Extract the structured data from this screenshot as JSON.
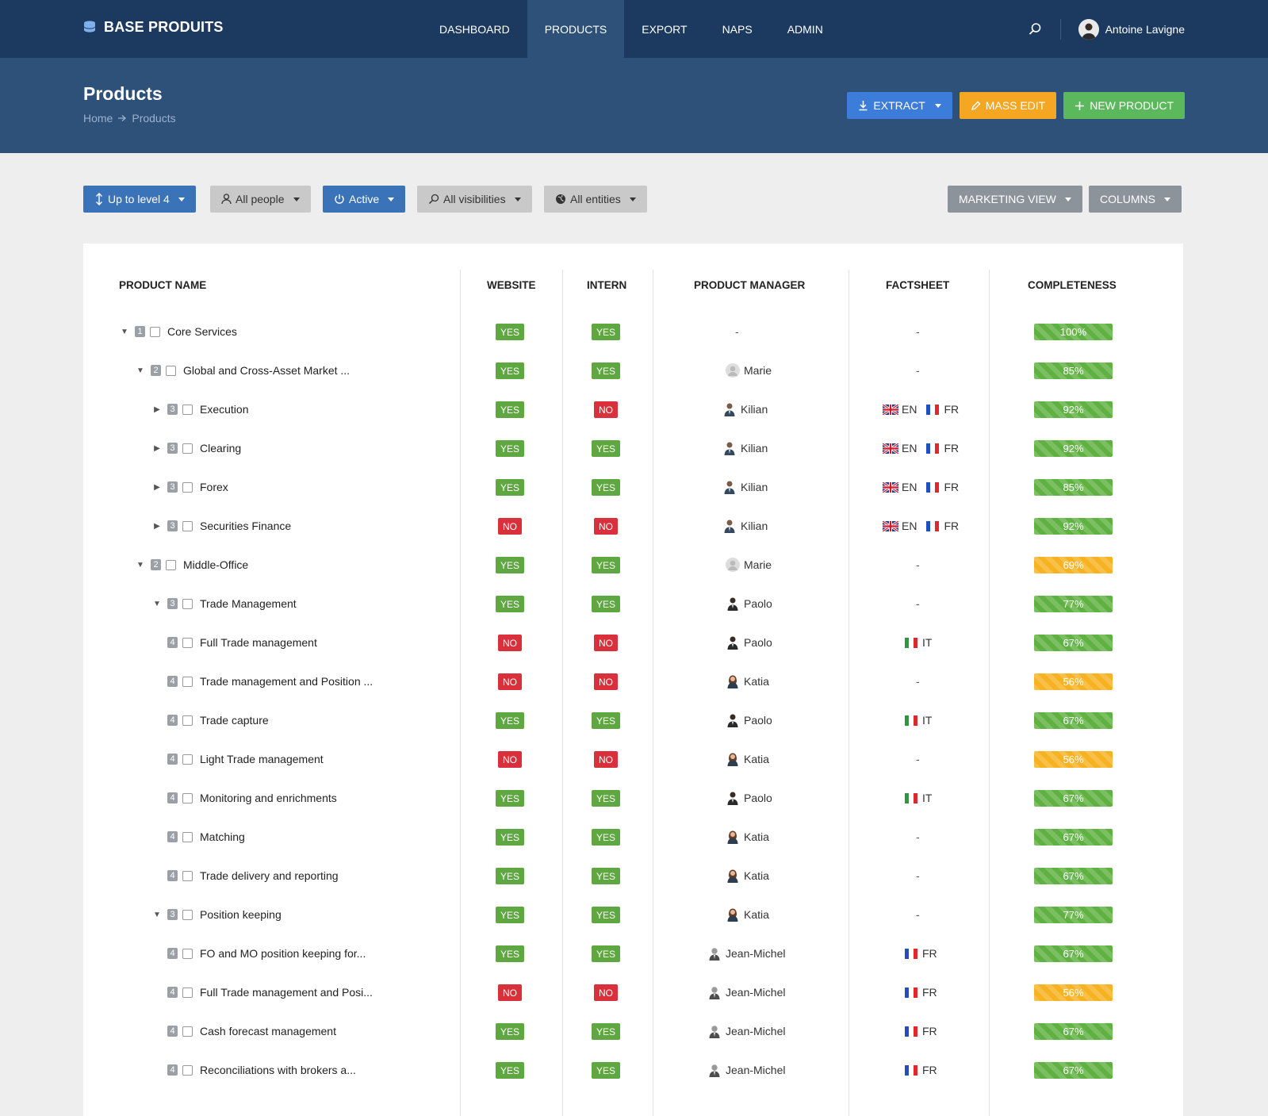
{
  "app": {
    "brand": "BASE PRODUITS",
    "user": "Antoine Lavigne"
  },
  "nav": [
    {
      "label": "DASHBOARD",
      "active": false
    },
    {
      "label": "PRODUCTS",
      "active": true
    },
    {
      "label": "EXPORT",
      "active": false
    },
    {
      "label": "NAPS",
      "active": false
    },
    {
      "label": "ADMIN",
      "active": false
    }
  ],
  "header": {
    "title": "Products",
    "breadcrumb": [
      "Home",
      "Products"
    ],
    "actions": {
      "extract": "EXTRACT",
      "mass_edit": "MASS EDIT",
      "new_product": "NEW PRODUCT"
    }
  },
  "filters": {
    "level": "Up to level 4",
    "people": "All people",
    "status": "Active",
    "visibility": "All visibilities",
    "entities": "All entities",
    "view": "MARKETING VIEW",
    "columns": "COLUMNS"
  },
  "table": {
    "headers": {
      "name": "PRODUCT NAME",
      "website": "WEBSITE",
      "intern": "INTERN",
      "manager": "PRODUCT MANAGER",
      "factsheet": "FACTSHEET",
      "completeness": "COMPLETENESS"
    },
    "rows": [
      {
        "level": "1",
        "toggle": "down",
        "name": "Core Services",
        "website": "YES",
        "intern": "YES",
        "manager": "-",
        "avatar": "",
        "factsheet": [],
        "completeness": "100%",
        "status": "green"
      },
      {
        "level": "2",
        "toggle": "down",
        "name": "Global and Cross-Asset Market ...",
        "website": "YES",
        "intern": "YES",
        "manager": "Marie",
        "avatar": "placeholder",
        "factsheet": [],
        "completeness": "85%",
        "status": "green"
      },
      {
        "level": "3",
        "toggle": "right",
        "name": "Execution",
        "website": "YES",
        "intern": "NO",
        "manager": "Kilian",
        "avatar": "man-suit",
        "factsheet": [
          "EN",
          "FR"
        ],
        "completeness": "92%",
        "status": "green"
      },
      {
        "level": "3",
        "toggle": "right",
        "name": "Clearing",
        "website": "YES",
        "intern": "YES",
        "manager": "Kilian",
        "avatar": "man-suit",
        "factsheet": [
          "EN",
          "FR"
        ],
        "completeness": "92%",
        "status": "green"
      },
      {
        "level": "3",
        "toggle": "right",
        "name": "Forex",
        "website": "YES",
        "intern": "YES",
        "manager": "Kilian",
        "avatar": "man-suit",
        "factsheet": [
          "EN",
          "FR"
        ],
        "completeness": "85%",
        "status": "green"
      },
      {
        "level": "3",
        "toggle": "right",
        "name": "Securities Finance",
        "website": "NO",
        "intern": "NO",
        "manager": "Kilian",
        "avatar": "man-suit",
        "factsheet": [
          "EN",
          "FR"
        ],
        "completeness": "92%",
        "status": "green"
      },
      {
        "level": "2",
        "toggle": "down",
        "name": "Middle-Office",
        "website": "YES",
        "intern": "YES",
        "manager": "Marie",
        "avatar": "placeholder",
        "factsheet": [],
        "completeness": "69%",
        "status": "orange"
      },
      {
        "level": "3",
        "toggle": "down",
        "name": "Trade Management",
        "website": "YES",
        "intern": "YES",
        "manager": "Paolo",
        "avatar": "man-dark",
        "factsheet": [],
        "completeness": "77%",
        "status": "green"
      },
      {
        "level": "4",
        "toggle": "",
        "name": "Full Trade management",
        "website": "NO",
        "intern": "NO",
        "manager": "Paolo",
        "avatar": "man-dark",
        "factsheet": [
          "IT"
        ],
        "completeness": "67%",
        "status": "green"
      },
      {
        "level": "4",
        "toggle": "",
        "name": "Trade management and Position ...",
        "website": "NO",
        "intern": "NO",
        "manager": "Katia",
        "avatar": "woman",
        "factsheet": [],
        "completeness": "56%",
        "status": "orange"
      },
      {
        "level": "4",
        "toggle": "",
        "name": "Trade capture",
        "website": "YES",
        "intern": "YES",
        "manager": "Paolo",
        "avatar": "man-dark",
        "factsheet": [
          "IT"
        ],
        "completeness": "67%",
        "status": "green"
      },
      {
        "level": "4",
        "toggle": "",
        "name": "Light Trade management",
        "website": "NO",
        "intern": "NO",
        "manager": "Katia",
        "avatar": "woman",
        "factsheet": [],
        "completeness": "56%",
        "status": "orange"
      },
      {
        "level": "4",
        "toggle": "",
        "name": "Monitoring and enrichments",
        "website": "YES",
        "intern": "YES",
        "manager": "Paolo",
        "avatar": "man-dark",
        "factsheet": [
          "IT"
        ],
        "completeness": "67%",
        "status": "green"
      },
      {
        "level": "4",
        "toggle": "",
        "name": "Matching",
        "website": "YES",
        "intern": "YES",
        "manager": "Katia",
        "avatar": "woman",
        "factsheet": [],
        "completeness": "67%",
        "status": "green"
      },
      {
        "level": "4",
        "toggle": "",
        "name": "Trade delivery and reporting",
        "website": "YES",
        "intern": "YES",
        "manager": "Katia",
        "avatar": "woman",
        "factsheet": [],
        "completeness": "67%",
        "status": "green"
      },
      {
        "level": "3",
        "toggle": "down",
        "name": "Position keeping",
        "website": "YES",
        "intern": "YES",
        "manager": "Katia",
        "avatar": "woman",
        "factsheet": [],
        "completeness": "77%",
        "status": "green"
      },
      {
        "level": "4",
        "toggle": "",
        "name": "FO and MO position keeping for...",
        "website": "YES",
        "intern": "YES",
        "manager": "Jean-Michel",
        "avatar": "man-grey",
        "factsheet": [
          "FR"
        ],
        "completeness": "67%",
        "status": "green"
      },
      {
        "level": "4",
        "toggle": "",
        "name": "Full Trade management and Posi...",
        "website": "NO",
        "intern": "NO",
        "manager": "Jean-Michel",
        "avatar": "man-grey",
        "factsheet": [
          "FR"
        ],
        "completeness": "56%",
        "status": "orange"
      },
      {
        "level": "4",
        "toggle": "",
        "name": "Cash forecast management",
        "website": "YES",
        "intern": "YES",
        "manager": "Jean-Michel",
        "avatar": "man-grey",
        "factsheet": [
          "FR"
        ],
        "completeness": "67%",
        "status": "green"
      },
      {
        "level": "4",
        "toggle": "",
        "name": "Reconciliations with brokers a...",
        "website": "YES",
        "intern": "YES",
        "manager": "Jean-Michel",
        "avatar": "man-grey",
        "factsheet": [
          "FR"
        ],
        "completeness": "67%",
        "status": "green"
      }
    ]
  },
  "colors": {
    "navy": "#1c3a5f",
    "header": "#2d5179",
    "yes": "#5fa841",
    "no": "#d9303b",
    "progress_green": "#5fb141",
    "progress_orange": "#f6b221"
  }
}
